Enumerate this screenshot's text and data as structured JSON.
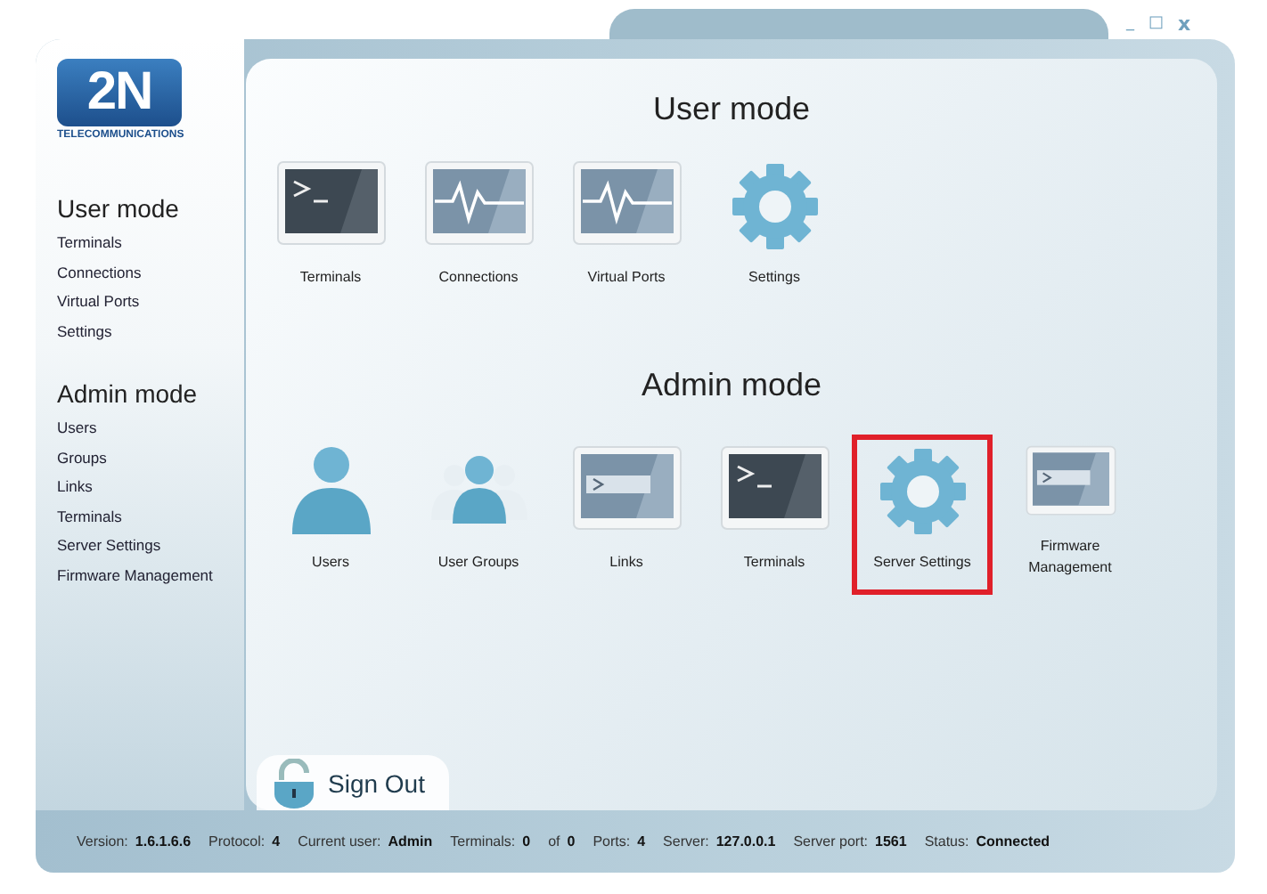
{
  "window_controls": [
    {
      "kind": "minimize",
      "text": "_"
    },
    {
      "kind": "maximize",
      "text": "□"
    },
    {
      "kind": "close",
      "text": "x"
    }
  ],
  "logo": {
    "mark": "2N",
    "caption": "TELECOMMUNICATIONS"
  },
  "sidebar": [
    {
      "title": "User mode",
      "items": [
        "Terminals",
        "Connections",
        "Virtual Ports",
        "Settings"
      ]
    },
    {
      "title": "Admin mode",
      "items": [
        "Users",
        "Groups",
        "Links",
        "Terminals",
        "Server Settings",
        "Firmware Management"
      ]
    }
  ],
  "sections": [
    {
      "title": "User mode",
      "tiles": [
        {
          "label": "Terminals",
          "kind": "terminal",
          "selected": false
        },
        {
          "label": "Connections",
          "kind": "wave",
          "selected": false
        },
        {
          "label": "Virtual Ports",
          "kind": "wave",
          "selected": false
        },
        {
          "label": "Settings",
          "kind": "gear",
          "selected": false
        }
      ]
    },
    {
      "title": "Admin mode",
      "tiles": [
        {
          "label": "Users",
          "kind": "user",
          "selected": false
        },
        {
          "label": "User Groups",
          "kind": "group",
          "selected": false
        },
        {
          "label": "Links",
          "kind": "prompt",
          "selected": false
        },
        {
          "label": "Terminals",
          "kind": "terminal",
          "selected": false
        },
        {
          "label": "Server Settings",
          "kind": "gear",
          "selected": true
        },
        {
          "label": "Firmware Management",
          "kind": "prompt",
          "selected": false
        }
      ]
    }
  ],
  "sign_out": "Sign Out",
  "status_bar": [
    {
      "text": "Version:",
      "kind": "label"
    },
    {
      "text": "1.6.1.6.6",
      "kind": "value"
    },
    {
      "text": "Protocol:",
      "kind": "label"
    },
    {
      "text": "4",
      "kind": "value"
    },
    {
      "text": "Current user:",
      "kind": "label"
    },
    {
      "text": "Admin",
      "kind": "value"
    },
    {
      "text": "Terminals:",
      "kind": "label"
    },
    {
      "text": "0",
      "kind": "value"
    },
    {
      "text": "of",
      "kind": "label"
    },
    {
      "text": "0",
      "kind": "value"
    },
    {
      "text": "Ports:",
      "kind": "label"
    },
    {
      "text": "4",
      "kind": "value"
    },
    {
      "text": "Server:",
      "kind": "label"
    },
    {
      "text": "127.0.0.1",
      "kind": "value"
    },
    {
      "text": "Server port:",
      "kind": "label"
    },
    {
      "text": "1561",
      "kind": "value"
    },
    {
      "text": "Status:",
      "kind": "label"
    },
    {
      "text": "Connected",
      "kind": "value"
    }
  ]
}
